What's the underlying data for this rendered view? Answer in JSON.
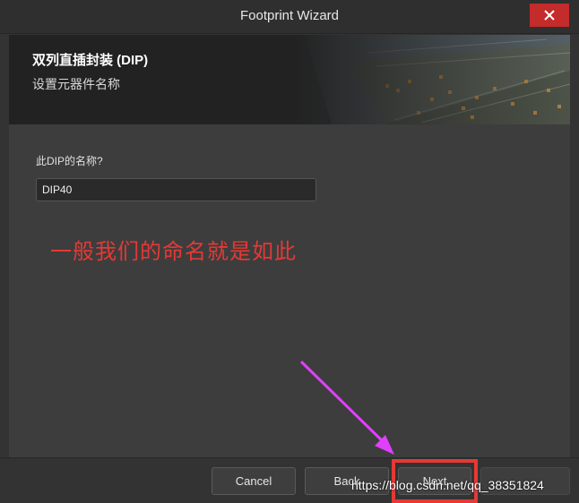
{
  "window": {
    "title": "Footprint Wizard"
  },
  "header": {
    "title": "双列直插封装 (DIP)",
    "subtitle": "设置元器件名称"
  },
  "form": {
    "label": "此DIP的名称?",
    "value": "DIP40"
  },
  "annotation": {
    "text": "一般我们的命名就是如此",
    "color": "#e53935"
  },
  "footer": {
    "cancel_label": "Cancel",
    "back_label": "Back",
    "next_label": "Next"
  },
  "watermark": {
    "text": "https://blog.csdn.net/qq_38351824"
  },
  "colors": {
    "close_button": "#c42b2b",
    "arrow": "#e040fb",
    "highlight": "#e53935"
  }
}
